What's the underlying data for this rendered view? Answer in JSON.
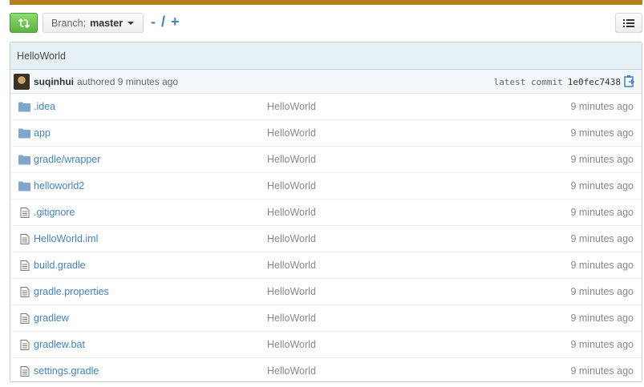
{
  "colors": {
    "accent": "#4183c4",
    "top_bar": "#b5801f",
    "compare_button": "#60b044",
    "header_bg": "#e6f1f6"
  },
  "toolbar": {
    "compare_icon": "compare-icon",
    "branch_label": "Branch:",
    "branch_name": "master",
    "breadcrumb_minus": "-",
    "breadcrumb_sep": "/",
    "breadcrumb_plus": "+",
    "list_icon": "list-icon"
  },
  "commit": {
    "title": "HelloWorld",
    "author": "suqinhui",
    "authored_text": "authored 9 minutes ago",
    "latest_label": "latest commit",
    "sha": "1e0fec7438",
    "copy_icon": "clipboard-icon"
  },
  "files": [
    {
      "name": ".idea",
      "type": "folder",
      "message": "HelloWorld",
      "age": "9 minutes ago"
    },
    {
      "name": "app",
      "type": "folder",
      "message": "HelloWorld",
      "age": "9 minutes ago"
    },
    {
      "name": "gradle/wrapper",
      "type": "folder",
      "message": "HelloWorld",
      "age": "9 minutes ago"
    },
    {
      "name": "helloworld2",
      "type": "folder",
      "message": "HelloWorld",
      "age": "9 minutes ago"
    },
    {
      "name": ".gitignore",
      "type": "file",
      "message": "HelloWorld",
      "age": "9 minutes ago"
    },
    {
      "name": "HelloWorld.iml",
      "type": "file",
      "message": "HelloWorld",
      "age": "9 minutes ago"
    },
    {
      "name": "build.gradle",
      "type": "file",
      "message": "HelloWorld",
      "age": "9 minutes ago"
    },
    {
      "name": "gradle.properties",
      "type": "file",
      "message": "HelloWorld",
      "age": "9 minutes ago"
    },
    {
      "name": "gradlew",
      "type": "file",
      "message": "HelloWorld",
      "age": "9 minutes ago"
    },
    {
      "name": "gradlew.bat",
      "type": "file",
      "message": "HelloWorld",
      "age": "9 minutes ago"
    },
    {
      "name": "settings.gradle",
      "type": "file",
      "message": "HelloWorld",
      "age": "9 minutes ago"
    }
  ]
}
